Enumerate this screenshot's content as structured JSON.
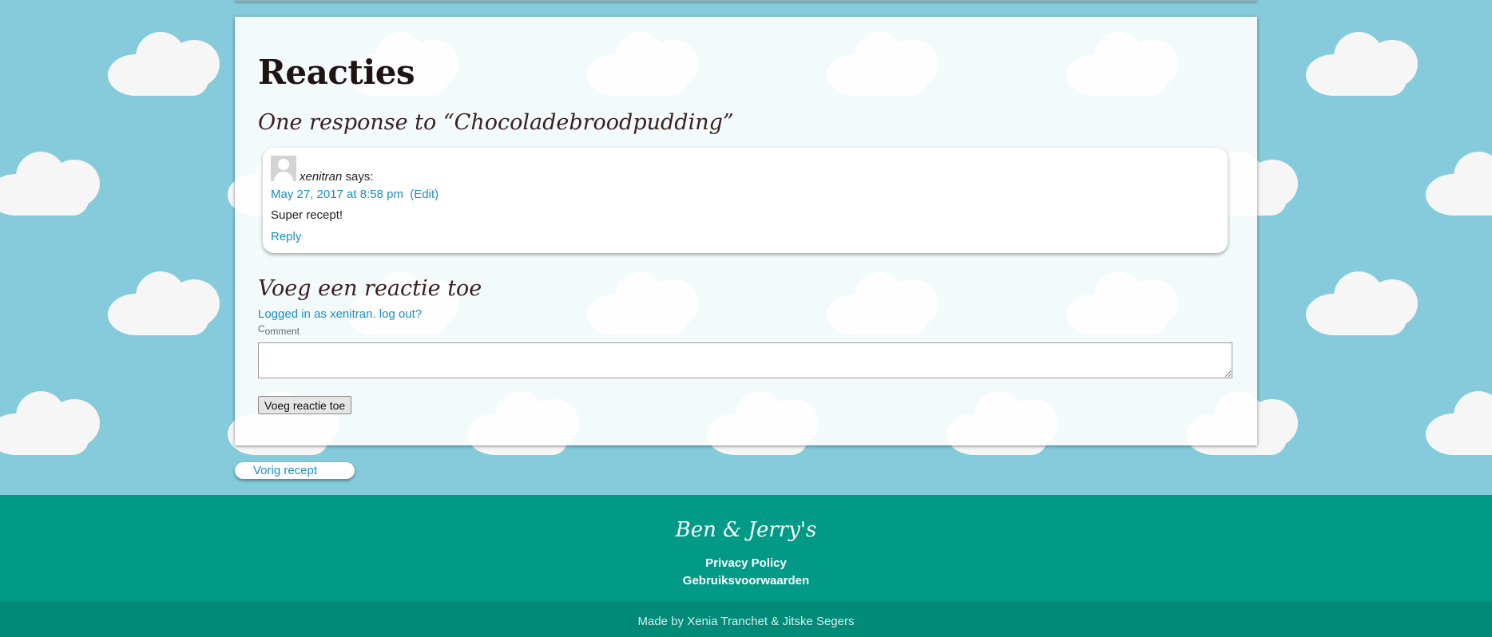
{
  "comments": {
    "heading": "Reacties",
    "count_title": "One response to “Chocoladebroodpudding”",
    "items": [
      {
        "author": "xenitran",
        "says": "says:",
        "date": "May 27, 2017 at 8:58 pm",
        "edit": "(Edit)",
        "text": "Super recept!",
        "reply": "Reply"
      }
    ]
  },
  "form": {
    "title": "Voeg een reactie toe",
    "logged_in_prefix": "Logged in as",
    "user": "xenitran",
    "logout": "log out?",
    "comment_label_first": "C",
    "comment_label_rest": "omment",
    "submit": "Voeg reactie toe"
  },
  "nav": {
    "previous": "Vorig recept"
  },
  "footer": {
    "brand": "Ben & Jerry's",
    "links": [
      "Privacy Policy",
      "Gebruiksvoorwaarden"
    ],
    "credit": "Made by Xenia Tranchet & Jitske Segers"
  },
  "colors": {
    "sky": "#86cbdc",
    "footer": "#009a86",
    "footer_bottom": "#008a78",
    "link": "#1e8ec0"
  }
}
